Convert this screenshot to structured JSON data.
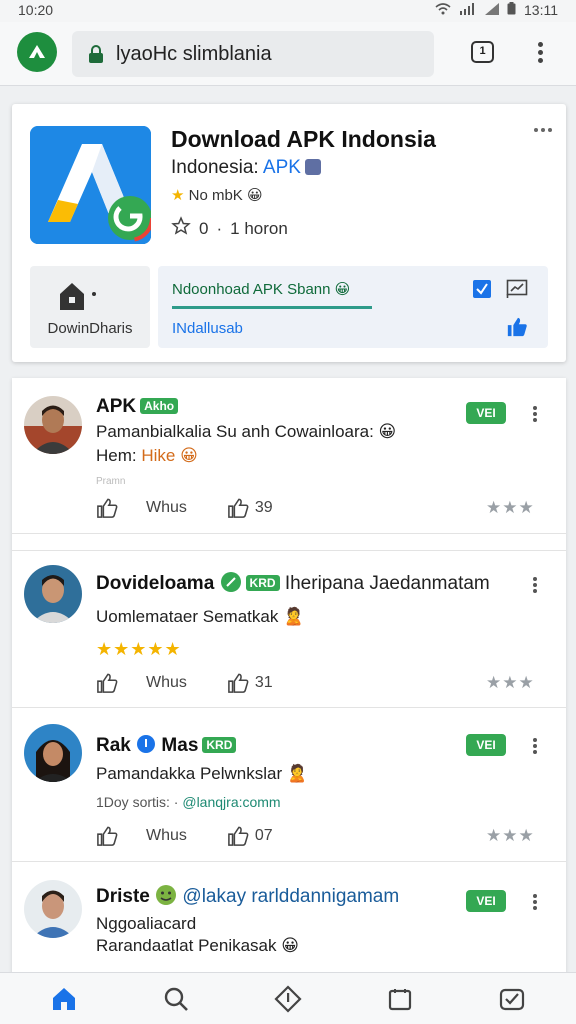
{
  "status_bar": {
    "time": "10:20",
    "clock": "13:11"
  },
  "browser": {
    "url": "lyaoHc slimblania",
    "tab_count": "1"
  },
  "app": {
    "title": "Download APK Indonsia",
    "developer": "Indonesia: ",
    "developer_accent": "APK",
    "meta_star": "★",
    "meta_text": "No mbK 😀",
    "rating_value": "0",
    "rating_separator": "·",
    "rating_time": "1 horon",
    "download_label": "DowinDharis",
    "banner_title": "Ndoonhoad APK Sbann 😀",
    "banner_sub": "INdallusab"
  },
  "reviews": [
    {
      "name": "APK",
      "tag": "Akho",
      "badge": "VEI",
      "text": "Pamanbialkalia Su anh Cowainloara: 😀",
      "line2_label": "Hem: ",
      "line2_highlight": "Hike 😀",
      "faint": "Pramn",
      "action_label": "Whus",
      "likes": "39",
      "rating": "★★★"
    },
    {
      "name": "Dovideloama",
      "tag": "KRD",
      "handle": "Iheripana Jaedanmatam",
      "text": "Uomlemataer Sematkak 🙎",
      "stars": "★★★★★",
      "action_label": "Whus",
      "likes": "31",
      "rating": "★★★"
    },
    {
      "name": "Rak",
      "name2": "Mas",
      "tag": "KRD",
      "badge": "VEI",
      "text": "Pamandakka Pelwnkslar 🙎",
      "sub_text": "1Doy sortis: · ",
      "sub_link": "@lanqjra:comm",
      "action_label": "Whus",
      "likes": "07",
      "rating": "★★★"
    },
    {
      "name": "Driste",
      "handle": "@lakay rarlddannigamam",
      "badge": "VEI",
      "text": "Nggoaliacard",
      "text2": "Rarandaatlat Penikasak 😀"
    }
  ],
  "colors": {
    "accent": "#1a73e8",
    "brand_green": "#34a853",
    "star": "#f4b400"
  }
}
